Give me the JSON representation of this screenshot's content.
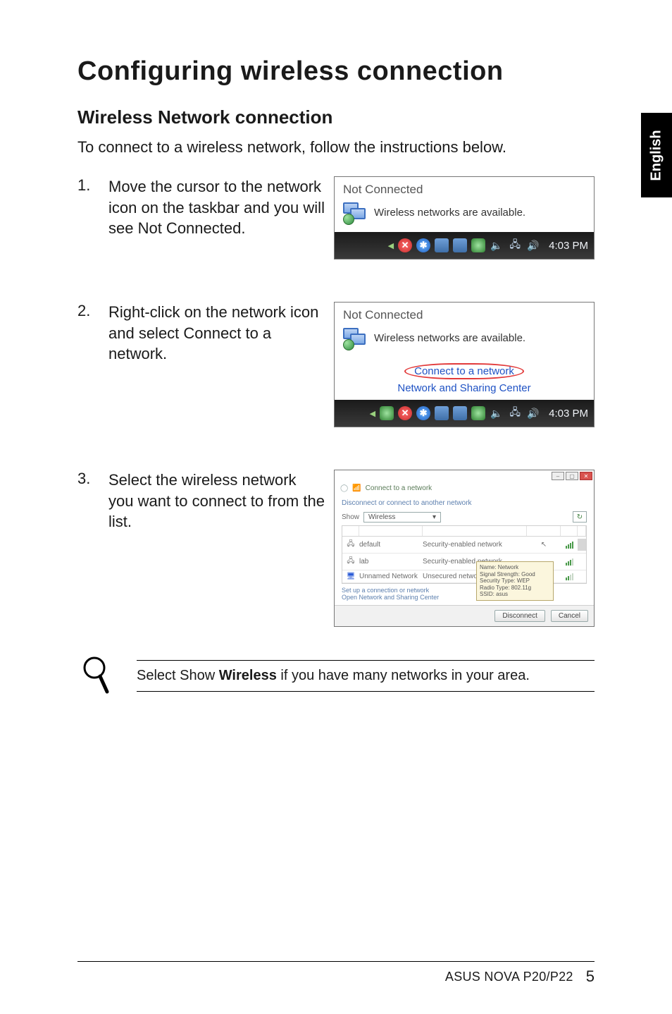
{
  "side_tab": "English",
  "h1": "Configuring wireless connection",
  "h2": "Wireless Network connection",
  "intro": "To connect to a wireless network, follow the instructions below.",
  "steps": [
    {
      "num": "1.",
      "text": "Move the cursor to the network icon on the taskbar and you will see Not Connected."
    },
    {
      "num": "2.",
      "text": "Right-click on the network icon and select Connect to a network."
    },
    {
      "num": "3.",
      "text": "Select the wireless network you want to connect to from the list."
    }
  ],
  "fig_common": {
    "title": "Not Connected",
    "subtitle": "Wireless networks are available."
  },
  "fig2_menu": {
    "item1": "Connect to a network",
    "item2": "Network and Sharing Center"
  },
  "taskbar": {
    "time": "4:03 PM"
  },
  "fig3": {
    "window_title": "Connect to a network",
    "prompt": "Disconnect or connect to another network",
    "show_label": "Show",
    "show_value": "Wireless",
    "rows": [
      {
        "name": "default",
        "desc": "Security-enabled network"
      },
      {
        "name": "lab",
        "desc": "Security-enabled network"
      },
      {
        "name": "Unnamed Network",
        "desc": "Unsecured network"
      }
    ],
    "tooltip": {
      "l1": "Name: Network",
      "l2": "Signal Strength: Good",
      "l3": "Security Type: WEP",
      "l4": "Radio Type: 802.11g",
      "l5": "SSID: asus"
    },
    "link1": "Set up a connection or network",
    "link2": "Open Network and Sharing Center",
    "btn_disconnect": "Disconnect",
    "btn_cancel": "Cancel"
  },
  "note": {
    "pre": "Select Show ",
    "bold": "Wireless",
    "post": " if you have many networks in your area."
  },
  "footer": {
    "product": "ASUS NOVA P20/P22",
    "page": "5"
  }
}
